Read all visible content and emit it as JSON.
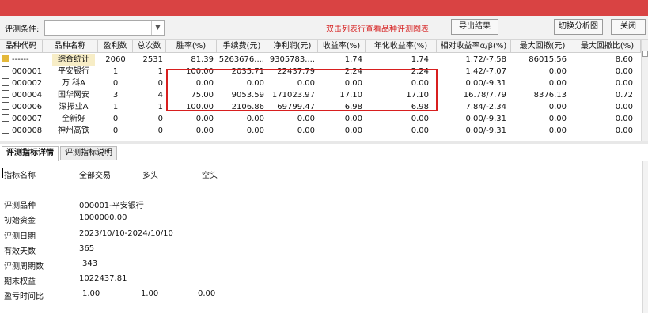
{
  "toolbar": {
    "filter_label": "评测条件:",
    "filter_value": "",
    "hint": "双击列表行查看品种评测图表",
    "export_button": "导出结果",
    "switch_button": "切换分析图",
    "close_button": "关闭"
  },
  "table": {
    "headers": [
      "品种代码",
      "品种名称",
      "盈利数",
      "总次数",
      "胜率(%)",
      "手续费(元)",
      "净利润(元)",
      "收益率(%)",
      "年化收益率(%)",
      "相对收益率α/β(%)",
      "最大回撤(元)",
      "最大回撤比(%)"
    ],
    "rows": [
      {
        "code": "------",
        "name": "综合统计",
        "win": "2060",
        "total": "2531",
        "rate": "81.39",
        "fee": "5263676....",
        "profit": "9305783....",
        "ret": "1.74",
        "annual": "1.74",
        "relative": "1.72/-7.58",
        "maxdd": "86015.56",
        "maxdd_ratio": "8.60"
      },
      {
        "code": "000001",
        "name": "平安银行",
        "win": "1",
        "total": "1",
        "rate": "100.00",
        "fee": "2035.71",
        "profit": "22437.79",
        "ret": "2.24",
        "annual": "2.24",
        "relative": "1.42/-7.07",
        "maxdd": "0.00",
        "maxdd_ratio": "0.00"
      },
      {
        "code": "000002",
        "name": "万 科A",
        "win": "0",
        "total": "0",
        "rate": "0.00",
        "fee": "0.00",
        "profit": "0.00",
        "ret": "0.00",
        "annual": "0.00",
        "relative": "0.00/-9.31",
        "maxdd": "0.00",
        "maxdd_ratio": "0.00"
      },
      {
        "code": "000004",
        "name": "国华网安",
        "win": "3",
        "total": "4",
        "rate": "75.00",
        "fee": "9053.59",
        "profit": "171023.97",
        "ret": "17.10",
        "annual": "17.10",
        "relative": "16.78/7.79",
        "maxdd": "8376.13",
        "maxdd_ratio": "0.72"
      },
      {
        "code": "000006",
        "name": "深振业A",
        "win": "1",
        "total": "1",
        "rate": "100.00",
        "fee": "2106.86",
        "profit": "69799.47",
        "ret": "6.98",
        "annual": "6.98",
        "relative": "7.84/-2.34",
        "maxdd": "0.00",
        "maxdd_ratio": "0.00"
      },
      {
        "code": "000007",
        "name": "全新好",
        "win": "0",
        "total": "0",
        "rate": "0.00",
        "fee": "0.00",
        "profit": "0.00",
        "ret": "0.00",
        "annual": "0.00",
        "relative": "0.00/-9.31",
        "maxdd": "0.00",
        "maxdd_ratio": "0.00"
      },
      {
        "code": "000008",
        "name": "神州高铁",
        "win": "0",
        "total": "0",
        "rate": "0.00",
        "fee": "0.00",
        "profit": "0.00",
        "ret": "0.00",
        "annual": "0.00",
        "relative": "0.00/-9.31",
        "maxdd": "0.00",
        "maxdd_ratio": "0.00"
      }
    ]
  },
  "tabs": {
    "detail": "评测指标详情",
    "explain": "评测指标说明"
  },
  "detail": {
    "header": {
      "name": "指标名称",
      "all": "全部交易",
      "long": "多头",
      "short": "空头"
    },
    "items": [
      {
        "label": "评测品种",
        "value": "000001-平安银行"
      },
      {
        "label": "初始资金",
        "value": "1000000.00"
      },
      {
        "label": "评测日期",
        "value": "2023/10/10-2024/10/10"
      },
      {
        "label": "有效天数",
        "value": "365"
      },
      {
        "label": "评测周期数",
        "value": "343"
      },
      {
        "label": "期末权益",
        "value": "1022437.81"
      }
    ],
    "ratio": {
      "label": "盈亏时间比",
      "all": "1.00",
      "long": "1.00",
      "short": "0.00"
    }
  },
  "colors": {
    "titlebar": "#d94343",
    "highlight_box": "#d81f1f",
    "hint": "#d62020",
    "selected_row": "#f7edc6"
  }
}
